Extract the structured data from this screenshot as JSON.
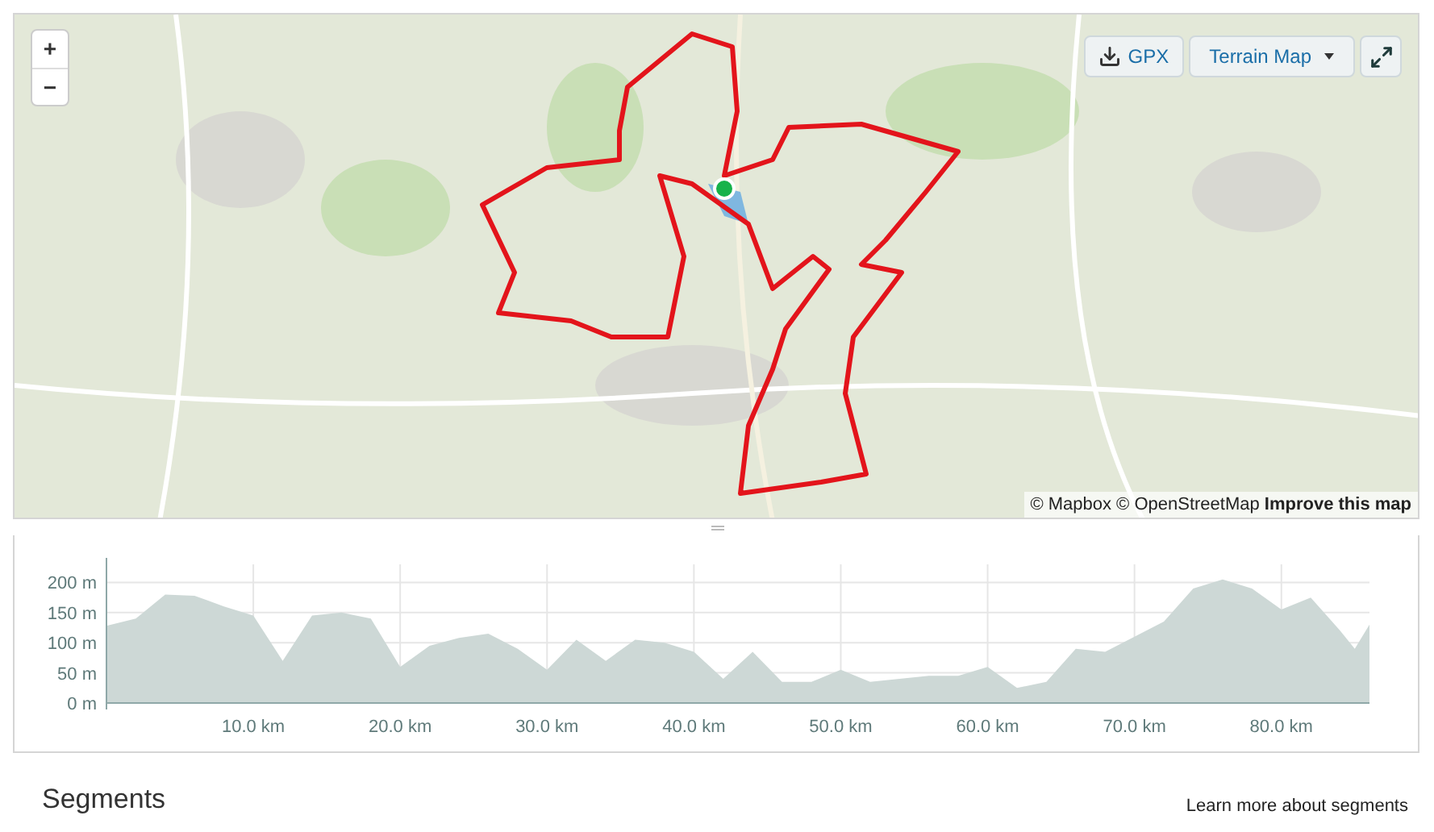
{
  "map": {
    "zoom_controls": [
      "+",
      "−"
    ],
    "buttons": [
      {
        "kind": "download",
        "label": "GPX"
      },
      {
        "kind": "dropdown",
        "label": "Terrain Map"
      },
      {
        "kind": "fullscreen"
      }
    ],
    "attribution": {
      "text": "© Mapbox © OpenStreetMap",
      "link": "Improve this map"
    }
  },
  "elevation": {
    "chart_data": {
      "type": "area",
      "x": [
        0,
        2,
        4,
        6,
        8,
        10,
        12,
        14,
        16,
        18,
        20,
        22,
        24,
        26,
        28,
        30,
        32,
        34,
        36,
        38,
        40,
        42,
        44,
        46,
        48,
        50,
        52,
        54,
        56,
        58,
        60,
        62,
        64,
        66,
        68,
        70,
        72,
        74,
        76,
        78,
        80,
        82,
        84,
        85,
        86
      ],
      "grid": true,
      "series": [
        {
          "color": "#cdd8d6",
          "values": [
            128,
            140,
            180,
            178,
            160,
            145,
            70,
            145,
            150,
            140,
            60,
            95,
            108,
            115,
            90,
            55,
            105,
            70,
            105,
            100,
            85,
            40,
            85,
            35,
            35,
            55,
            35,
            40,
            45,
            45,
            60,
            25,
            35,
            90,
            85,
            110,
            135,
            190,
            205,
            190,
            155,
            175,
            120,
            90,
            130
          ]
        }
      ],
      "xlim": [
        0,
        86
      ],
      "ylim": [
        0,
        230
      ],
      "xticks": [
        {
          "value": 10,
          "label": "10.0 km"
        },
        {
          "value": 20,
          "label": "20.0 km"
        },
        {
          "value": 30,
          "label": "30.0 km"
        },
        {
          "value": 40,
          "label": "40.0 km"
        },
        {
          "value": 50,
          "label": "50.0 km"
        },
        {
          "value": 60,
          "label": "60.0 km"
        },
        {
          "value": 70,
          "label": "70.0 km"
        },
        {
          "value": 80,
          "label": "80.0 km"
        }
      ],
      "yticks": [
        {
          "value": 0,
          "label": "0 m"
        },
        {
          "value": 50,
          "label": "50 m"
        },
        {
          "value": 100,
          "label": "100 m"
        },
        {
          "value": 150,
          "label": "150 m"
        },
        {
          "value": 200,
          "label": "200 m"
        }
      ]
    }
  },
  "segments": {
    "title": "Segments",
    "link": "Learn more about segments"
  }
}
